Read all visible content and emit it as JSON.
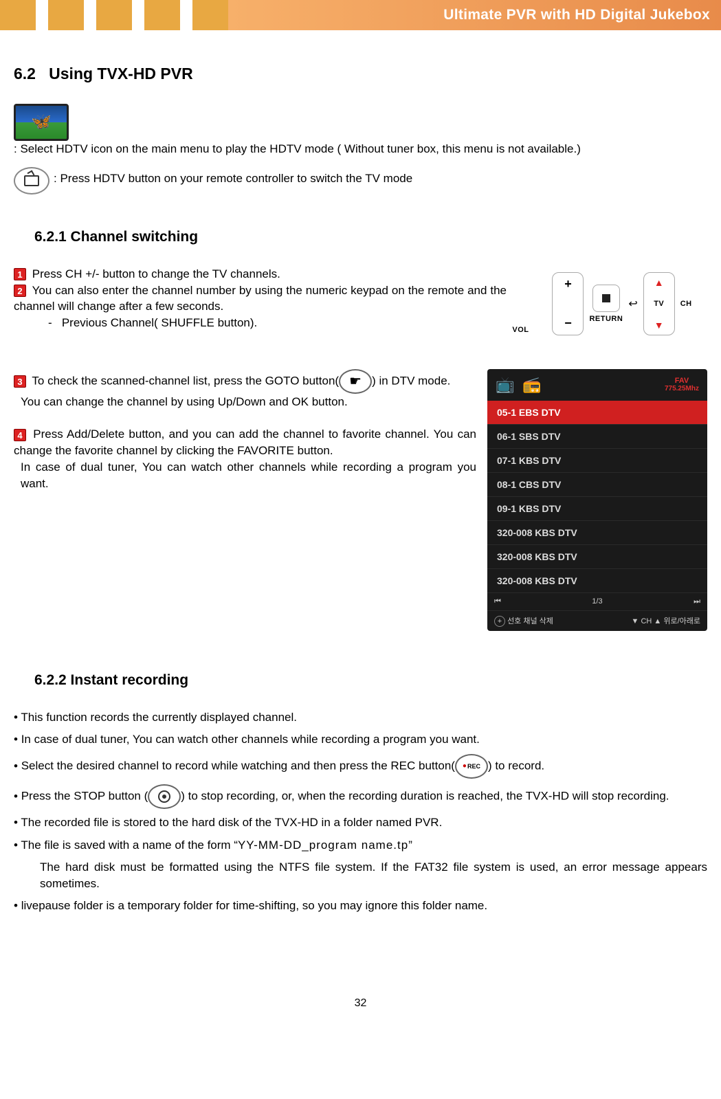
{
  "header_title": "Ultimate PVR with HD Digital Jukebox",
  "section": {
    "number": "6.2",
    "title": "Using TVX-HD PVR"
  },
  "intro": {
    "line1": ": Select HDTV icon on the main menu to play the HDTV mode ( Without tuner box, this menu is not available.)",
    "line2": ": Press HDTV button on your remote controller to switch the TV mode"
  },
  "sub_621": {
    "title": "6.2.1 Channel switching",
    "step1": "Press CH +/- button to change the TV channels.",
    "step2": "You can also enter the channel number by using the numeric keypad on the remote and the channel will change after a few seconds.",
    "step2b": "Previous Channel( SHUFFLE button).",
    "step3a": "To check the scanned-channel list, press the GOTO button(",
    "step3b": ") in DTV mode.",
    "step3c": "You can change the channel by using Up/Down and OK button.",
    "step4a": "Press Add/Delete button, and you can add the channel to favorite channel. You can change the favorite channel by clicking the FAVORITE button.",
    "step4b": "In case of dual tuner, You can watch other channels while recording a program you want."
  },
  "remote": {
    "vol_label": "VOL",
    "return_label": "RETURN",
    "tv_label": "TV",
    "ch_label": "CH"
  },
  "channel_list": {
    "fav_label": "FAV",
    "fav_freq": "775.25Mhz",
    "items": [
      "05-1 EBS DTV",
      "06-1 SBS DTV",
      "07-1 KBS DTV",
      "08-1 CBS DTV",
      "09-1 KBS DTV",
      "320-008 KBS DTV",
      "320-008 KBS DTV",
      "320-008 KBS DTV"
    ],
    "page": "1/3",
    "foot_left": "선호 채널 삭제",
    "foot_right": "▼ CH ▲ 위로/아래로"
  },
  "sub_622": {
    "title": "6.2.2 Instant recording",
    "b1": "This function records the currently displayed channel.",
    "b2": "In case of dual tuner, You can watch other channels while recording a program you want.",
    "b3a": "Select the desired channel to record while watching and then press the REC button(",
    "b3b": ") to record.",
    "b4a": "Press the STOP button (",
    "b4b": ") to stop recording, or, when the recording duration is reached, the TVX-HD will stop recording.",
    "b5": "The recorded file is stored to the hard disk of the TVX-HD in a folder named PVR.",
    "b6a": "The file is saved with a name of the form “",
    "b6_filename": "YY-MM-DD_program name.tp",
    "b6b": "”",
    "b6_note": "The hard disk must be formatted using the NTFS file system. If the FAT32 file system is used, an error message appears sometimes.",
    "b7": "livepause folder is a temporary folder for time-shifting, so you may ignore this folder name."
  },
  "page_number": "32"
}
